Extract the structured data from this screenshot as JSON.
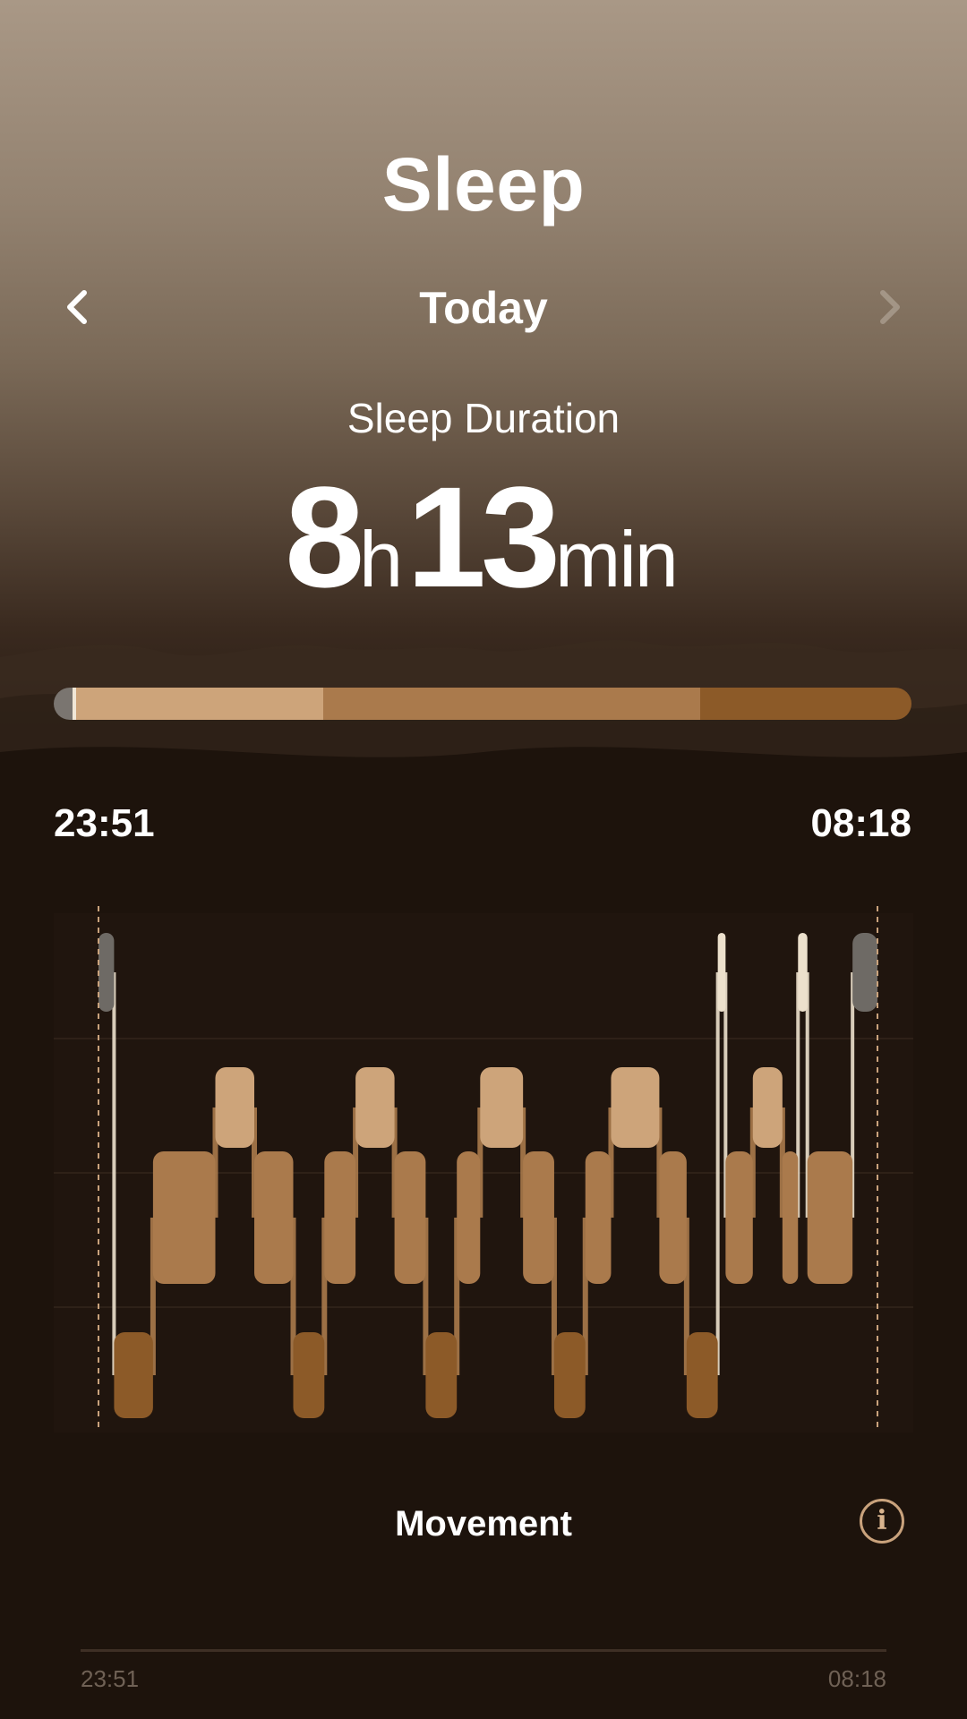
{
  "header": {
    "title": "Sleep"
  },
  "nav": {
    "period": "Today",
    "prev_icon": "chevron-left-icon",
    "next_icon": "chevron-right-icon",
    "next_enabled": false
  },
  "duration": {
    "label": "Sleep Duration",
    "hours": "8",
    "hours_unit": "h",
    "minutes": "13",
    "minutes_unit": "min"
  },
  "stage_bar": {
    "segments": [
      {
        "stage": "awake",
        "fraction": 0.022,
        "color": "#7a7570"
      },
      {
        "stage": "marker",
        "fraction": 0.004,
        "color": "#f0e6d6"
      },
      {
        "stage": "light",
        "fraction": 0.288,
        "color": "#cda47a"
      },
      {
        "stage": "core",
        "fraction": 0.44,
        "color": "#aa7a4c"
      },
      {
        "stage": "deep",
        "fraction": 0.246,
        "color": "#8c5a28"
      }
    ]
  },
  "time_range": {
    "start": "23:51",
    "end": "08:18"
  },
  "hypnogram": {
    "colors": {
      "awake": "#6e6a65",
      "light": "#cda47a",
      "core": "#aa7a4c",
      "deep": "#8c5a28",
      "spike": "#ece0cc"
    },
    "blocks": [
      {
        "level": "awake",
        "start": 0.0,
        "end": 0.02
      },
      {
        "level": "deep",
        "start": 0.02,
        "end": 0.07
      },
      {
        "level": "core",
        "start": 0.07,
        "end": 0.15
      },
      {
        "level": "light",
        "start": 0.15,
        "end": 0.2
      },
      {
        "level": "core",
        "start": 0.2,
        "end": 0.25
      },
      {
        "level": "deep",
        "start": 0.25,
        "end": 0.29
      },
      {
        "level": "core",
        "start": 0.29,
        "end": 0.33
      },
      {
        "level": "light",
        "start": 0.33,
        "end": 0.38
      },
      {
        "level": "core",
        "start": 0.38,
        "end": 0.42
      },
      {
        "level": "deep",
        "start": 0.42,
        "end": 0.46
      },
      {
        "level": "core",
        "start": 0.46,
        "end": 0.49
      },
      {
        "level": "light",
        "start": 0.49,
        "end": 0.545
      },
      {
        "level": "core",
        "start": 0.545,
        "end": 0.585
      },
      {
        "level": "deep",
        "start": 0.585,
        "end": 0.625
      },
      {
        "level": "core",
        "start": 0.625,
        "end": 0.658
      },
      {
        "level": "light",
        "start": 0.658,
        "end": 0.72
      },
      {
        "level": "core",
        "start": 0.72,
        "end": 0.755
      },
      {
        "level": "deep",
        "start": 0.755,
        "end": 0.795
      },
      {
        "level": "awake",
        "start": 0.795,
        "end": 0.805
      },
      {
        "level": "core",
        "start": 0.805,
        "end": 0.84
      },
      {
        "level": "light",
        "start": 0.84,
        "end": 0.878
      },
      {
        "level": "core",
        "start": 0.878,
        "end": 0.898
      },
      {
        "level": "awake",
        "start": 0.898,
        "end": 0.91
      },
      {
        "level": "core",
        "start": 0.91,
        "end": 0.968
      },
      {
        "level": "awake",
        "start": 0.968,
        "end": 1.0
      }
    ]
  },
  "movement": {
    "title": "Movement",
    "info_icon": "info-icon",
    "info_label": "i",
    "start": "23:51",
    "end": "08:18"
  }
}
